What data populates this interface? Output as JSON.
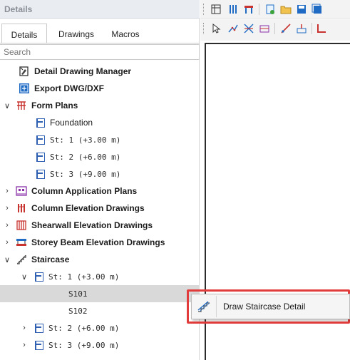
{
  "panel": {
    "title": "Details",
    "tabs": [
      "Details",
      "Drawings",
      "Macros"
    ],
    "search_placeholder": "Search"
  },
  "tree": [
    {
      "label": "Detail Drawing Manager",
      "bold": true,
      "icon": "drawing-manager-icon"
    },
    {
      "label": "Export DWG/DXF",
      "bold": true,
      "icon": "export-dwg-icon"
    },
    {
      "label": "Form Plans",
      "bold": true,
      "icon": "form-plans-icon",
      "expanded": true
    },
    {
      "label": "Foundation",
      "icon": "plan-icon"
    },
    {
      "label": "St: 1 (+3.00 m)",
      "icon": "plan-icon"
    },
    {
      "label": "St: 2 (+6.00 m)",
      "icon": "plan-icon"
    },
    {
      "label": "St: 3 (+9.00 m)",
      "icon": "plan-icon"
    },
    {
      "label": "Column Application Plans",
      "bold": true,
      "icon": "column-plans-icon",
      "expanded": false
    },
    {
      "label": "Column Elevation Drawings",
      "bold": true,
      "icon": "column-elevation-icon",
      "expanded": false
    },
    {
      "label": "Shearwall Elevation Drawings",
      "bold": true,
      "icon": "shearwall-icon",
      "expanded": false
    },
    {
      "label": "Storey Beam Elevation Drawings",
      "bold": true,
      "icon": "beam-icon",
      "expanded": false
    },
    {
      "label": "Staircase",
      "bold": true,
      "icon": "staircase-icon",
      "expanded": true
    },
    {
      "label": "St: 1 (+3.00 m)",
      "icon": "plan-icon",
      "expanded": true
    },
    {
      "label": "S101",
      "selected": true
    },
    {
      "label": "S102"
    },
    {
      "label": "St: 2 (+6.00 m)",
      "icon": "plan-icon",
      "expanded": false
    },
    {
      "label": "St: 3 (+9.00 m)",
      "icon": "plan-icon",
      "expanded": false
    }
  ],
  "context_menu": {
    "item": "Draw Staircase Detail",
    "icon": "staircase-detail-icon"
  },
  "colors": {
    "highlight_outline": "#e23b3b",
    "selection": "#d9d9d9",
    "accent_blue": "#2f5fb3"
  }
}
